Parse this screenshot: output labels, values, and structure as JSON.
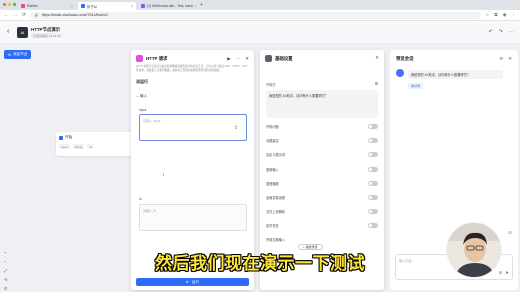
{
  "browser": {
    "tabs": [
      {
        "label": "Rabbis",
        "active": false
      },
      {
        "label": "扣子AI",
        "active": true
      },
      {
        "label": "(1) Webhooks.site - Test, trans",
        "active": false
      }
    ],
    "url": "https://kmab.xiaohuazu.cn/a/7041/flow/v3",
    "window_colors": [
      "#ff5f57",
      "#febc2e",
      "#28c840"
    ]
  },
  "app": {
    "title": "HTTP节点演示",
    "subtitle": "已自动保存 14:22:45",
    "logo_text": "AI"
  },
  "canvas": {
    "add_node_label": "添加节点",
    "node": {
      "title": "开始",
      "field1": "input",
      "field2": "String",
      "field3": "id"
    },
    "zoom_controls": [
      "+",
      "−",
      "⤢",
      "⟲",
      "⊡"
    ]
  },
  "http_panel": {
    "title": "HTTP 请求",
    "desc": "HTTP 请求节点是专为发送各类网络请求而设计的实用工具。它可以用于发送 GET、POST、PUT 等请求，获取第三方服务数据，或者将工作流的处理结果传递给外部系统。",
    "run_title": "试运行",
    "input_section": "输入",
    "input_label": "input",
    "input_placeholder": "请输入 input",
    "id_label": "id",
    "id_placeholder": "请输入 id",
    "run_button": "运行"
  },
  "settings_panel": {
    "title": "基础设置",
    "welcome_label": "开场白",
    "welcome_text": "我是您的 AI 助手，请问有什么需要帮忙？",
    "options": [
      {
        "label": "开场问题",
        "on": false
      },
      {
        "label": "问题建议",
        "on": false
      },
      {
        "label": "自定义提示词",
        "on": false
      },
      {
        "label": "语音输入",
        "on": false
      },
      {
        "label": "语音播报",
        "on": false
      },
      {
        "label": "全局变量设置",
        "on": false
      },
      {
        "label": "文件上传解析",
        "on": false
      },
      {
        "label": "定时任务",
        "on": false
      }
    ],
    "voice_label": "开场文案输入",
    "voice_button": "+ 播放录音"
  },
  "chat": {
    "title": "预览会话",
    "bot_message": "我是您的 AI 助手，请问有什么需要帮忙？",
    "suggestion": "你好呀",
    "input_placeholder": "输入内容..."
  },
  "subtitle": "然后我们现在演示一下测试",
  "colors": {
    "accent": "#2e6cf6",
    "http_icon": "#e14fd9",
    "subtitle": "#ffe43c"
  }
}
